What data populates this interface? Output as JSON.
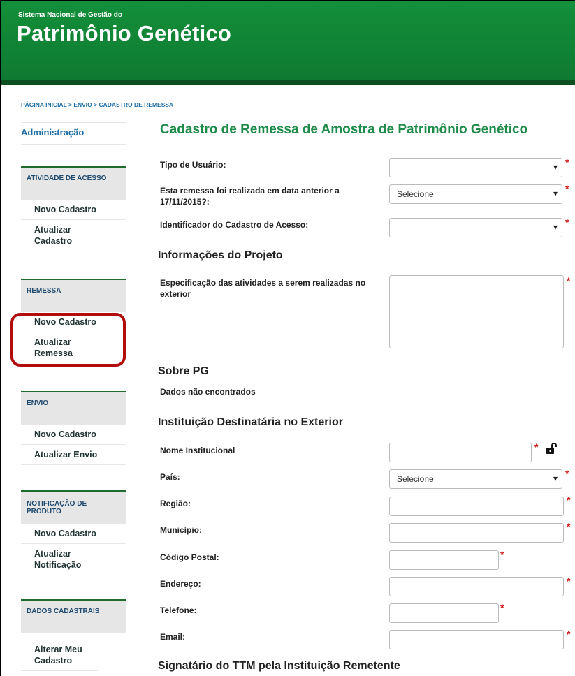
{
  "header": {
    "subtitle": "Sistema Nacional de Gestão do",
    "title": "Patrimônio Genético"
  },
  "breadcrumb": "PÁGINA INICIAL > ENVIO > CADASTRO DE REMESSA",
  "sidebar": {
    "top_link": "Administração",
    "groups": [
      {
        "title": "ATIVIDADE DE ACESSO",
        "items": [
          "Novo Cadastro",
          "Atualizar Cadastro"
        ]
      },
      {
        "title": "REMESSA",
        "items": [
          "Novo Cadastro",
          "Atualizar Remessa"
        ]
      },
      {
        "title": "ENVIO",
        "items": [
          "Novo Cadastro",
          "Atualizar Envio"
        ]
      },
      {
        "title": "NOTIFICAÇÃO DE PRODUTO",
        "items": [
          "Novo Cadastro",
          "Atualizar Notificação"
        ]
      },
      {
        "title": "DADOS CADASTRAIS",
        "items": [
          "Alterar Meu Cadastro"
        ]
      }
    ]
  },
  "main": {
    "title": "Cadastro de Remessa de Amostra de Patrimônio Genético",
    "fields": {
      "tipo_usuario": "Tipo de Usuário:",
      "data_anterior": "Esta remessa foi realizada em data anterior a 17/11/2015?:",
      "data_anterior_value": "Selecione",
      "identificador": "Identificador do Cadastro de Acesso:"
    },
    "sections": {
      "projeto": "Informações do Projeto",
      "sobre_pg": "Sobre PG",
      "instituicao": "Instituição Destinatária no Exterior",
      "signatario": "Signatário do TTM pela Instituição Remetente"
    },
    "especificacao": "Especificação das atividades a serem realizadas no exterior",
    "sem_dados": "Dados não encontrados",
    "instituicao_fields": {
      "nome": "Nome Institucional",
      "pais": "País:",
      "pais_value": "Selecione",
      "regiao": "Região:",
      "municipio": "Município:",
      "codigo_postal": "Código Postal:",
      "endereco": "Endereço:",
      "telefone": "Telefone:",
      "email": "Email:"
    },
    "required_mark": "*"
  },
  "colors": {
    "header_green": "#138f3a",
    "title_green": "#1e8b4a",
    "link_blue": "#1f6fa8",
    "required_red": "#d21c1c",
    "highlight_red": "#b10d0d"
  }
}
